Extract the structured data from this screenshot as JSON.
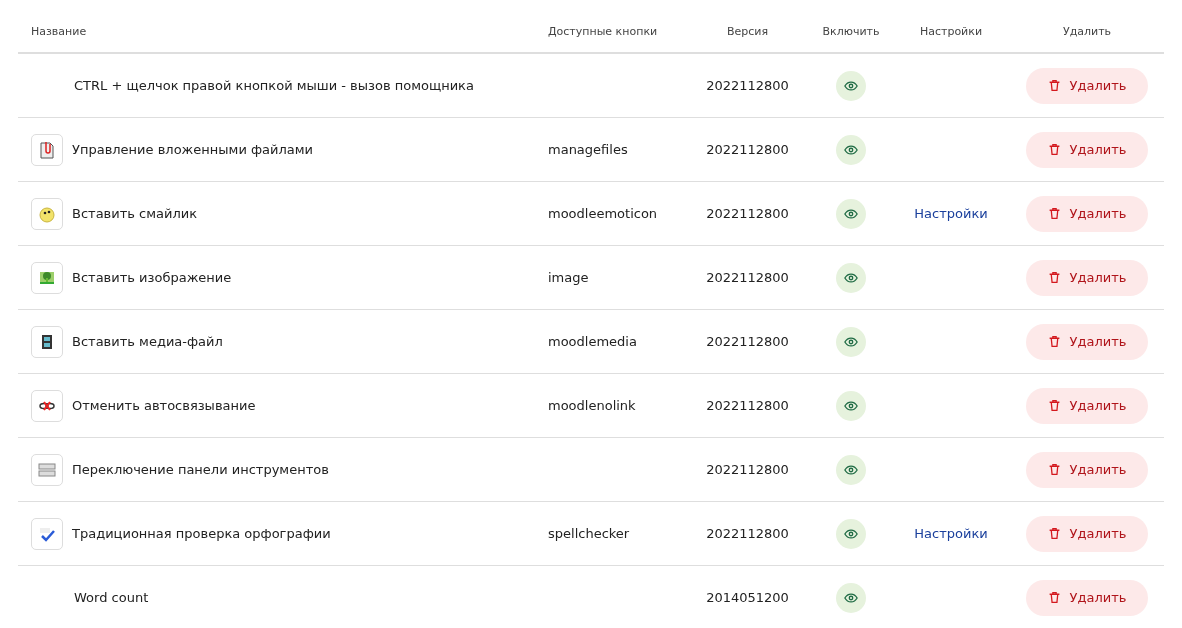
{
  "table": {
    "columns": [
      "Название",
      "Доступные кнопки",
      "Версия",
      "Включить",
      "Настройки",
      "Удалить"
    ],
    "rows": [
      {
        "kind": "none",
        "name": "CTRL + щелчок правой кнопкой мыши - вызов помощника",
        "buttons": "",
        "version": "2022112800",
        "enabled": true,
        "settings": "",
        "delete": "Удалить"
      },
      {
        "kind": "file",
        "name": "Управление вложенными файлами",
        "buttons": "managefiles",
        "version": "2022112800",
        "enabled": true,
        "settings": "",
        "delete": "Удалить"
      },
      {
        "kind": "smiley",
        "name": "Вставить смайлик",
        "buttons": "moodleemoticon",
        "version": "2022112800",
        "enabled": true,
        "settings": "Настройки",
        "delete": "Удалить"
      },
      {
        "kind": "image",
        "name": "Вставить изображение",
        "buttons": "image",
        "version": "2022112800",
        "enabled": true,
        "settings": "",
        "delete": "Удалить"
      },
      {
        "kind": "media",
        "name": "Вставить медиа-файл",
        "buttons": "moodlemedia",
        "version": "2022112800",
        "enabled": true,
        "settings": "",
        "delete": "Удалить"
      },
      {
        "kind": "unlink",
        "name": "Отменить автосвязывание",
        "buttons": "moodlenolink",
        "version": "2022112800",
        "enabled": true,
        "settings": "",
        "delete": "Удалить"
      },
      {
        "kind": "toolbar",
        "name": "Переключение панели инструментов",
        "buttons": "",
        "version": "2022112800",
        "enabled": true,
        "settings": "",
        "delete": "Удалить"
      },
      {
        "kind": "spellcheck",
        "name": "Традиционная проверка орфографии",
        "buttons": "spellchecker",
        "version": "2022112800",
        "enabled": true,
        "settings": "Настройки",
        "delete": "Удалить"
      },
      {
        "kind": "none",
        "name": "Word count",
        "buttons": "",
        "version": "2014051200",
        "enabled": true,
        "settings": "",
        "delete": "Удалить"
      }
    ]
  }
}
